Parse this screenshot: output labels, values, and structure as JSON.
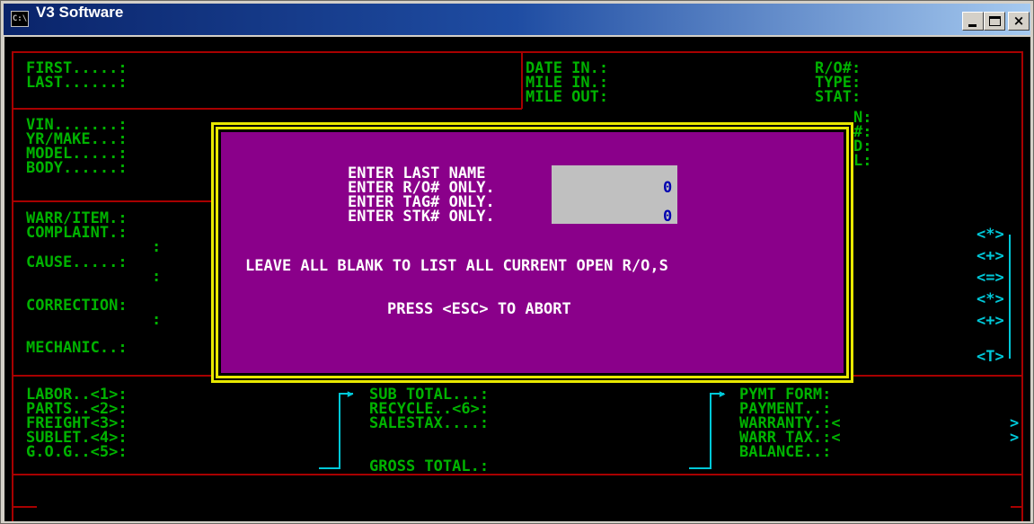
{
  "window": {
    "title": "V3 Software",
    "icon_text": "C:\\",
    "min_label": "_",
    "max_label": "",
    "close_label": "×"
  },
  "customer": {
    "first": "FIRST.....:",
    "last": "LAST......:"
  },
  "ro_info": {
    "date_in": "DATE IN.:",
    "mile_in": "MILE IN.:",
    "mile_out": "MILE OUT:",
    "ro_num": "R/O#:",
    "type": "TYPE:",
    "stat": "STAT:",
    "partial_n": "N:",
    "partial_hash": "#:",
    "partial_d": "D:",
    "partial_l": "L:"
  },
  "vehicle": {
    "vin": "VIN.......:",
    "yrmake": "YR/MAKE...:",
    "model": "MODEL.....:",
    "body": "BODY......:"
  },
  "job": {
    "warr_item": "WARR/ITEM.:",
    "complaint": "COMPLAINT.:",
    "complaint_cont": ":",
    "cause": "CAUSE.....:",
    "cause_cont": ":",
    "correction": "CORRECTION:",
    "correction_cont": ":",
    "mechanic": "MECHANIC..:"
  },
  "side_codes": [
    "<*>",
    "<+>",
    "<=>",
    "<*>",
    "<+>",
    "<T>"
  ],
  "totals": {
    "labor": "LABOR..<1>:",
    "parts": "PARTS..<2>:",
    "freight": "FREIGHT<3>:",
    "sublet": "SUBLET.<4>:",
    "gog": "G.O.G..<5>:",
    "sub_total": "SUB TOTAL...:",
    "recycle": "RECYCLE..<6>:",
    "salestax": "SALESTAX....:",
    "gross_total": "GROSS TOTAL.:",
    "pymt_form": "PYMT FORM:",
    "payment": "PAYMENT..:",
    "warranty": "WARRANTY.:<",
    "warr_tax": "WARR TAX.:<",
    "balance": "BALANCE..:",
    "close_angle_1": ">",
    "close_angle_2": ">"
  },
  "dialog": {
    "line1": "ENTER LAST NAME",
    "line2": "ENTER R/O# ONLY.",
    "line3": "ENTER TAG# ONLY.",
    "line4": "ENTER STK# ONLY.",
    "ro_value": "0",
    "stk_value": "0",
    "message": "LEAVE ALL BLANK TO LIST ALL CURRENT OPEN R/O,S",
    "abort": "PRESS <ESC> TO ABORT"
  }
}
